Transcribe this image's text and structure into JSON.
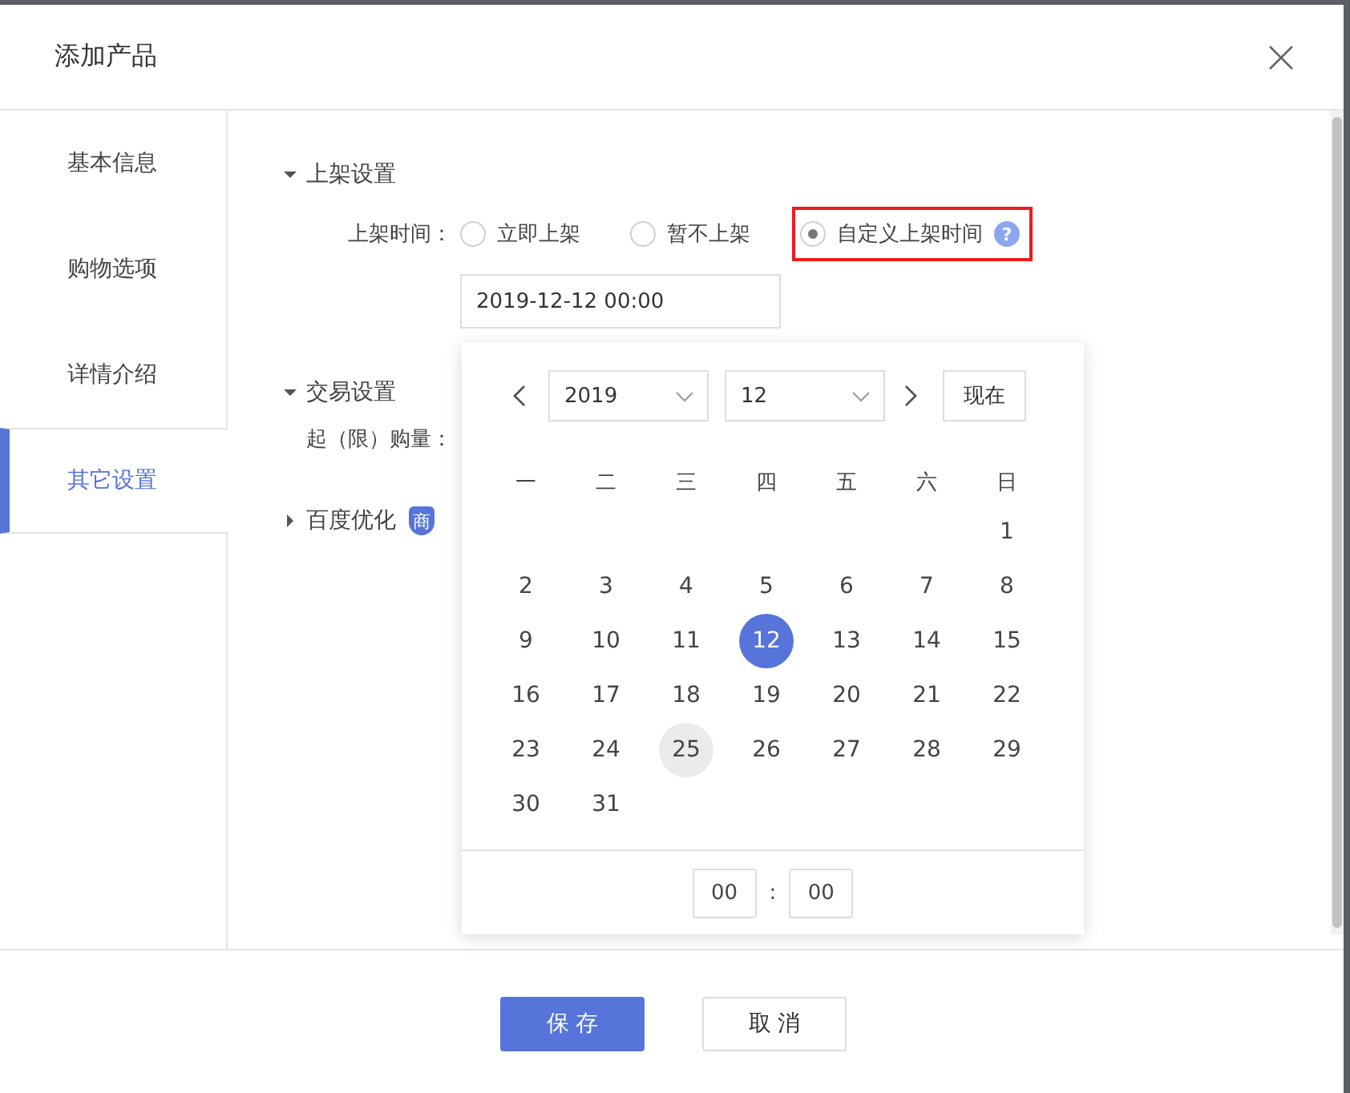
{
  "dialog": {
    "title": "添加产品"
  },
  "sidebar": {
    "items": [
      {
        "label": "基本信息",
        "selected": false
      },
      {
        "label": "购物选项",
        "selected": false
      },
      {
        "label": "详情介绍",
        "selected": false
      },
      {
        "label": "其它设置",
        "selected": true
      }
    ]
  },
  "sections": [
    {
      "title": "上架设置",
      "expanded": true,
      "fields": [
        {
          "kind": "radio",
          "label": "上架时间：",
          "options": [
            {
              "label": "立即上架",
              "selected": false,
              "annotated": false
            },
            {
              "label": "暂不上架",
              "selected": false,
              "annotated": false
            },
            {
              "label": "自定义上架时间",
              "selected": true,
              "annotated": true,
              "help": "?"
            }
          ],
          "value": "2019-12-12 00:00"
        }
      ]
    },
    {
      "title": "交易设置",
      "expanded": true,
      "fields": [
        {
          "kind": "label",
          "label": "起（限）购量："
        }
      ]
    },
    {
      "title": "百度优化",
      "expanded": false,
      "badge": "商"
    }
  ],
  "date_picker": {
    "year": "2019",
    "month": "12",
    "now_button": "现在",
    "weekdays": [
      "一",
      "二",
      "三",
      "四",
      "五",
      "六",
      "日"
    ],
    "weeks": [
      [
        {
          "label": "1",
          "selected": false,
          "hovered": false
        }
      ],
      [
        {
          "label": "2",
          "selected": false,
          "hovered": false
        },
        {
          "label": "3",
          "selected": false,
          "hovered": false
        },
        {
          "label": "4",
          "selected": false,
          "hovered": false
        },
        {
          "label": "5",
          "selected": false,
          "hovered": false
        },
        {
          "label": "6",
          "selected": false,
          "hovered": false
        },
        {
          "label": "7",
          "selected": false,
          "hovered": false
        },
        {
          "label": "8",
          "selected": false,
          "hovered": false
        }
      ],
      [
        {
          "label": "9",
          "selected": false,
          "hovered": false
        },
        {
          "label": "10",
          "selected": false,
          "hovered": false
        },
        {
          "label": "11",
          "selected": false,
          "hovered": false
        },
        {
          "label": "12",
          "selected": true,
          "hovered": false
        },
        {
          "label": "13",
          "selected": false,
          "hovered": false
        },
        {
          "label": "14",
          "selected": false,
          "hovered": false
        },
        {
          "label": "15",
          "selected": false,
          "hovered": false
        }
      ],
      [
        {
          "label": "16",
          "selected": false,
          "hovered": false
        },
        {
          "label": "17",
          "selected": false,
          "hovered": false
        },
        {
          "label": "18",
          "selected": false,
          "hovered": false
        },
        {
          "label": "19",
          "selected": false,
          "hovered": false
        },
        {
          "label": "20",
          "selected": false,
          "hovered": false
        },
        {
          "label": "21",
          "selected": false,
          "hovered": false
        },
        {
          "label": "22",
          "selected": false,
          "hovered": false
        }
      ],
      [
        {
          "label": "23",
          "selected": false,
          "hovered": false
        },
        {
          "label": "24",
          "selected": false,
          "hovered": false
        },
        {
          "label": "25",
          "selected": false,
          "hovered": true
        },
        {
          "label": "26",
          "selected": false,
          "hovered": false
        },
        {
          "label": "27",
          "selected": false,
          "hovered": false
        },
        {
          "label": "28",
          "selected": false,
          "hovered": false
        },
        {
          "label": "29",
          "selected": false,
          "hovered": false
        }
      ],
      [
        {
          "label": "30",
          "selected": false,
          "hovered": false
        },
        {
          "label": "31",
          "selected": false,
          "hovered": false
        }
      ]
    ],
    "hour": "00",
    "separator": ":",
    "minute": "00"
  },
  "buttons": [
    {
      "label": "保 存",
      "kind": "primary"
    },
    {
      "label": "取 消",
      "kind": "default"
    }
  ]
}
